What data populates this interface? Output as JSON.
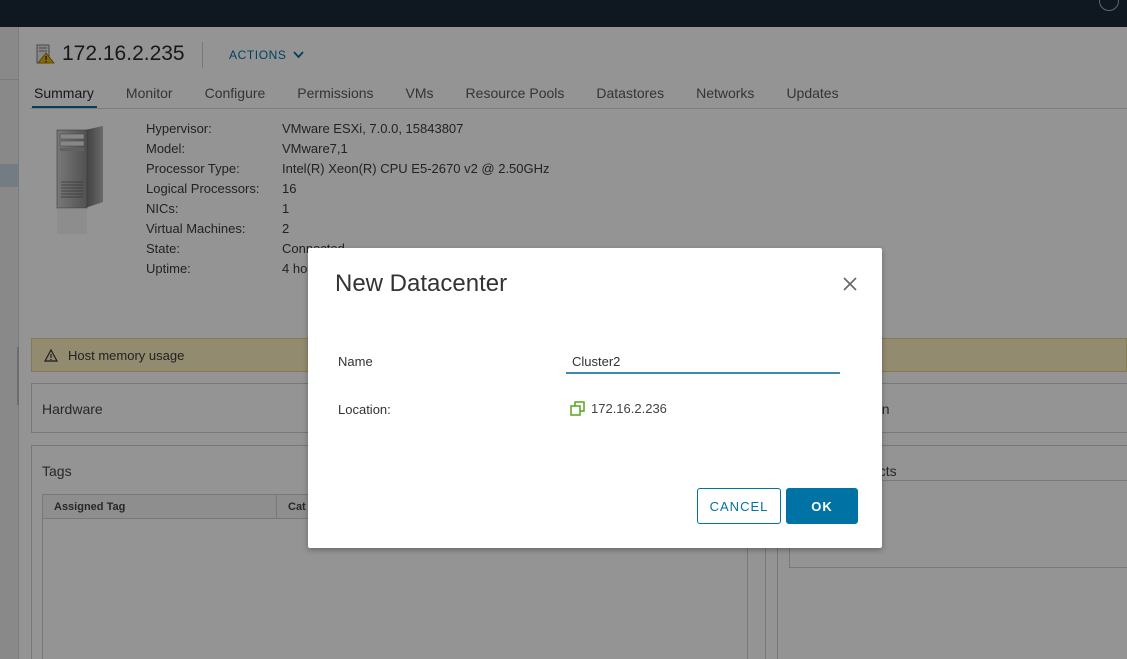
{
  "host": {
    "title": "172.16.2.235",
    "actions_label": "ACTIONS"
  },
  "tabs": [
    {
      "label": "Summary"
    },
    {
      "label": "Monitor"
    },
    {
      "label": "Configure"
    },
    {
      "label": "Permissions"
    },
    {
      "label": "VMs"
    },
    {
      "label": "Resource Pools"
    },
    {
      "label": "Datastores"
    },
    {
      "label": "Networks"
    },
    {
      "label": "Updates"
    }
  ],
  "summary": {
    "hypervisor_k": "Hypervisor:",
    "hypervisor_v": "VMware ESXi, 7.0.0, 15843807",
    "model_k": "Model:",
    "model_v": "VMware7,1",
    "cpu_k": "Processor Type:",
    "cpu_v": "Intel(R) Xeon(R) CPU E5-2670 v2 @ 2.50GHz",
    "lp_k": "Logical Processors:",
    "lp_v": "16",
    "nics_k": "NICs:",
    "nics_v": "1",
    "vms_k": "Virtual Machines:",
    "vms_v": "2",
    "state_k": "State:",
    "state_v": "Connected",
    "uptime_k": "Uptime:",
    "uptime_v": "4 ho"
  },
  "warning": {
    "text": "Host memory usage"
  },
  "cards": {
    "hardware_title": "Hardware",
    "config_title_partial": "on",
    "tags_title": "Tags",
    "objects_title_partial": "ects",
    "tags_col_assigned": "Assigned Tag",
    "tags_col_category": "Cat"
  },
  "modal": {
    "title": "New Datacenter",
    "name_label": "Name",
    "name_value": "Cluster2",
    "location_label": "Location:",
    "location_value": "172.16.2.236",
    "cancel_label": "CANCEL",
    "ok_label": "OK"
  },
  "colors": {
    "accent": "#0072a3",
    "topbar": "#1b2a3a",
    "warning_bg": "#fbf0c0",
    "location_icon": "#5aa220"
  }
}
